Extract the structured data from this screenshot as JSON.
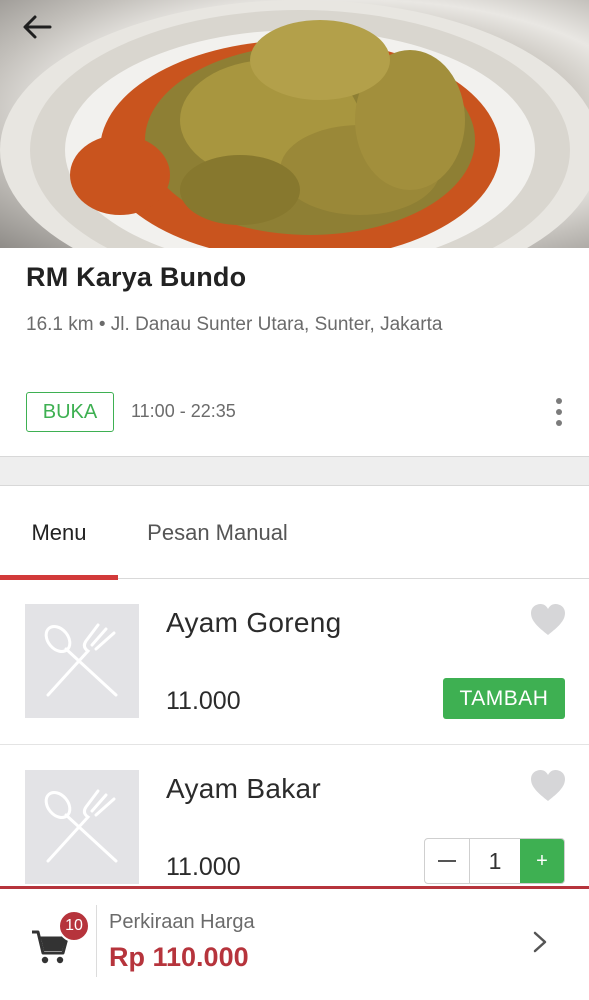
{
  "hero": {
    "image": "food-photo-chicken-curry"
  },
  "nav": {
    "back_icon": "arrow-left-icon"
  },
  "restaurant": {
    "name": "RM Karya Bundo",
    "meta": "16.1 km • Jl. Danau Sunter Utara, Sunter, Jakarta",
    "status": "BUKA",
    "hours": "11:00 - 22:35"
  },
  "tabs": [
    {
      "label": "Menu",
      "active": true
    },
    {
      "label": "Pesan Manual",
      "active": false
    }
  ],
  "items": [
    {
      "name": "Ayam Goreng",
      "price": "11.000",
      "action_label": "TAMBAH",
      "quantity": null
    },
    {
      "name": "Ayam Bakar",
      "price": "11.000",
      "action_label": null,
      "quantity": "1",
      "minus": "−",
      "plus": "+"
    }
  ],
  "cart": {
    "count": "10",
    "label": "Perkiraan Harga",
    "total": "Rp 110.000"
  },
  "colors": {
    "accent_green": "#3eb052",
    "accent_red": "#b6343c",
    "tab_underline": "#d23a3a"
  }
}
